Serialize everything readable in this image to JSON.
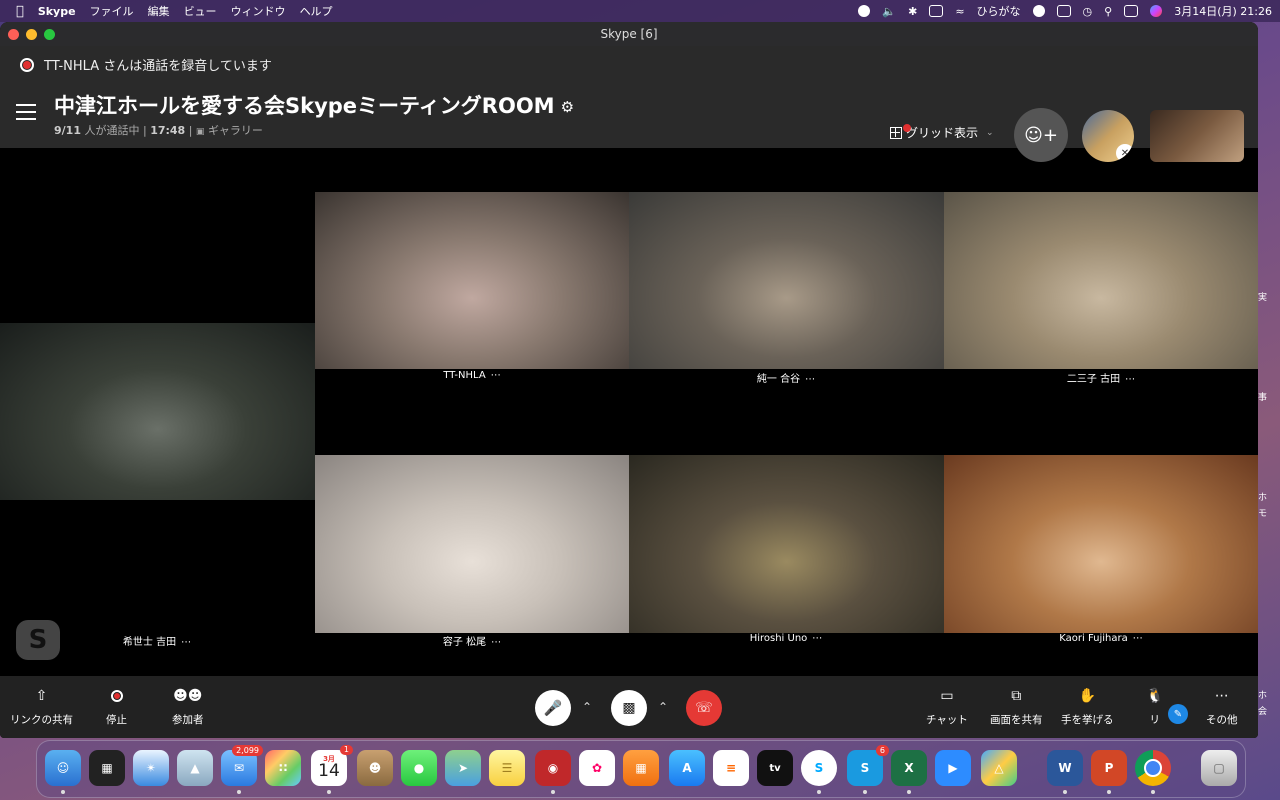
{
  "menubar": {
    "app": "Skype",
    "items": [
      "ファイル",
      "編集",
      "ビュー",
      "ウィンドウ",
      "ヘルプ"
    ],
    "input_mode": "ひらがな",
    "clock": "3月14日(月)  21:26"
  },
  "window": {
    "title": "Skype [6]"
  },
  "header": {
    "recording_text": "TT-NHLA さんは通話を録音しています",
    "call_title": "中津江ホールを愛する会SkypeミーティングROOM",
    "subtitle_count": "9/11",
    "subtitle_status": "人が通話中 |",
    "subtitle_time": "17:48",
    "subtitle_sep": "|",
    "subtitle_view": "ギャラリー",
    "grid_view_label": "グリッド表示"
  },
  "participants": [
    {
      "name": "TT-NHLA",
      "colors": [
        "#3a3430",
        "#8a7a70",
        "#c0a8a0"
      ]
    },
    {
      "name": "純一 合谷",
      "colors": [
        "#3a3a38",
        "#6a6258",
        "#a89a88"
      ]
    },
    {
      "name": "二三子 古田",
      "colors": [
        "#5a5448",
        "#9a8a70",
        "#c8b8a0"
      ]
    },
    {
      "name": "希世士 吉田",
      "colors": [
        "#1a1e1c",
        "#3a4038",
        "#6a7068"
      ]
    },
    {
      "name": "容子 松尾",
      "colors": [
        "#8a8480",
        "#c8c0b8",
        "#e8e0d8"
      ]
    },
    {
      "name": "Hiroshi Uno",
      "colors": [
        "#2a2820",
        "#5a5040",
        "#9a8a60"
      ]
    },
    {
      "name": "Kaori Fujihara",
      "colors": [
        "#6a3a20",
        "#b07848",
        "#e0b890"
      ]
    }
  ],
  "controls": {
    "share_link": "リンクの共有",
    "stop": "停止",
    "participants": "参加者",
    "chat": "チャット",
    "screen_share": "画面を共有",
    "raise_hand": "手を挙げる",
    "react": "リ",
    "more": "その他"
  },
  "dock": {
    "mail_badge": "2,099",
    "calendar_month": "3月",
    "calendar_day": "14",
    "calendar_badge": "1",
    "skype_badge": "6"
  },
  "side_text": [
    "実",
    "事",
    "ホ",
    "モ",
    "ホ",
    "会"
  ],
  "colors": {
    "record_red": "#e03030",
    "hangup_red": "#e53935",
    "header_bg": "#2a2a2a",
    "control_bg": "#222222"
  }
}
